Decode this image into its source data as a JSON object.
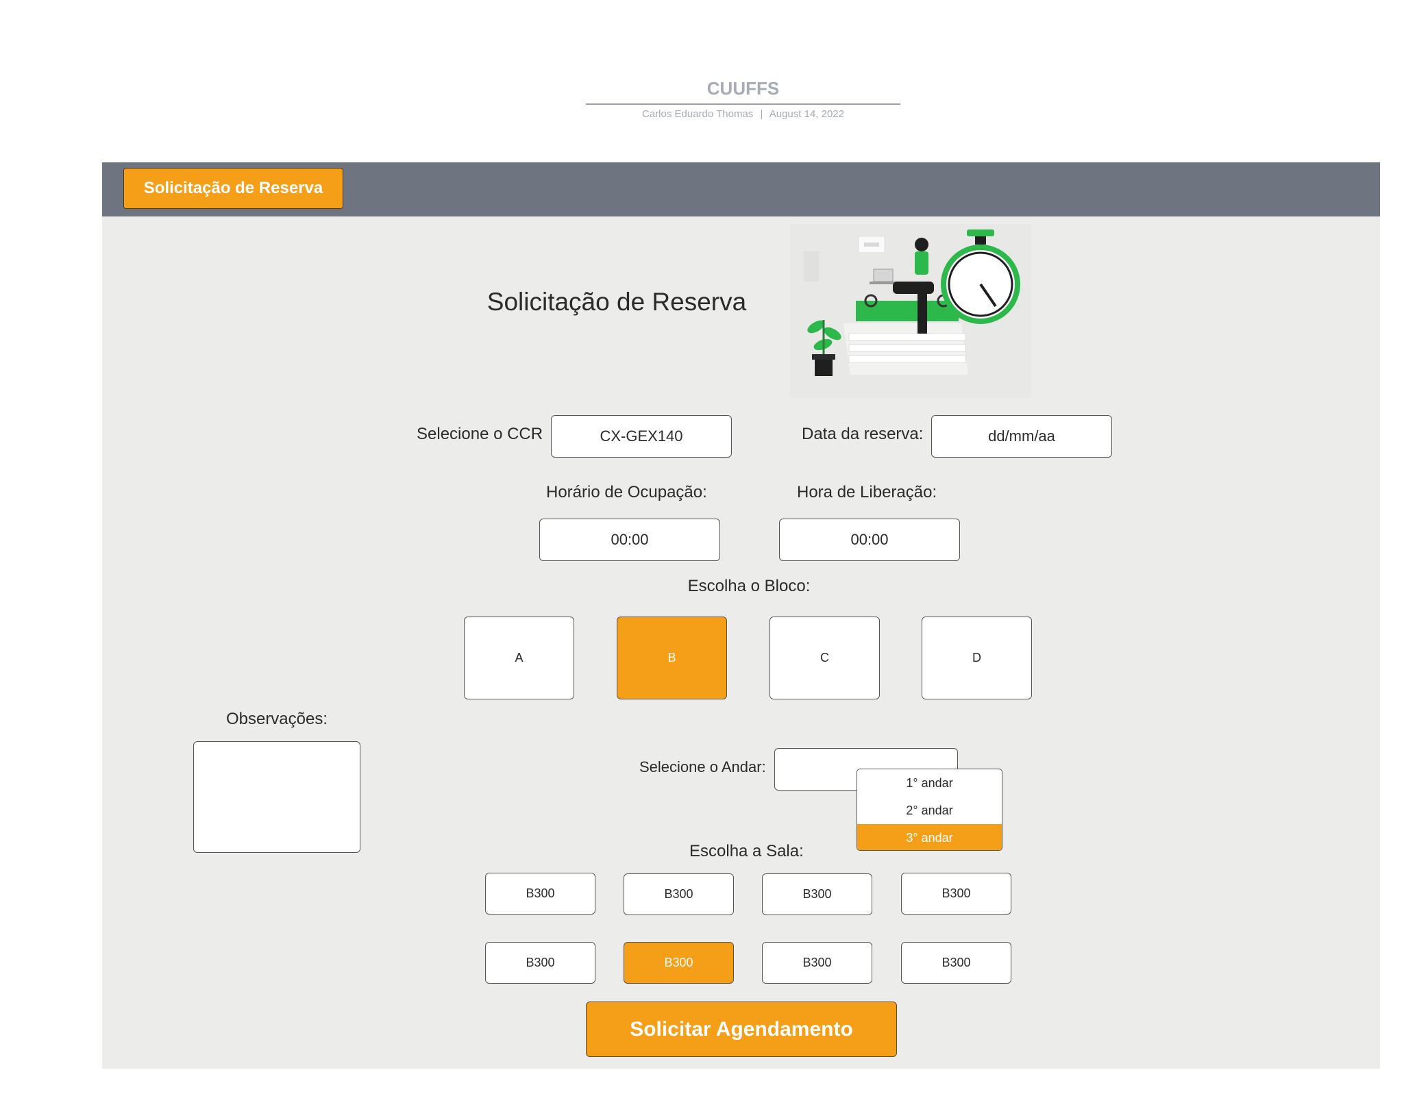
{
  "header": {
    "title": "CUUFFS",
    "author": "Carlos Eduardo Thomas",
    "separator": "|",
    "date": "August 14, 2022"
  },
  "topbar": {
    "tab_label": "Solicitação de Reserva"
  },
  "form": {
    "title": "Solicitação de Reserva",
    "ccr_label": "Selecione o CCR",
    "ccr_value": "CX-GEX140",
    "date_label": "Data da reserva:",
    "date_value": "dd/mm/aa",
    "start_label": "Horário de Ocupação:",
    "start_value": "00:00",
    "end_label": "Hora de Liberação:",
    "end_value": "00:00",
    "block_label": "Escolha o Bloco:",
    "blocks": [
      "A",
      "B",
      "C",
      "D"
    ],
    "selected_block": "B",
    "notes_label": "Observações:",
    "floor_label": "Selecione o Andar:",
    "floor_options": [
      "1° andar",
      "2° andar",
      "3° andar"
    ],
    "selected_floor": "3° andar",
    "room_label": "Escolha a Sala:",
    "rooms": [
      "B300",
      "B300",
      "B300",
      "B300",
      "B300",
      "B300",
      "B300",
      "B300"
    ],
    "selected_room_index": 5,
    "submit_label": "Solicitar Agendamento"
  },
  "colors": {
    "accent": "#f59e17",
    "topbar": "#6e7480",
    "panel": "#ececea",
    "illustration_green": "#2db84b"
  }
}
